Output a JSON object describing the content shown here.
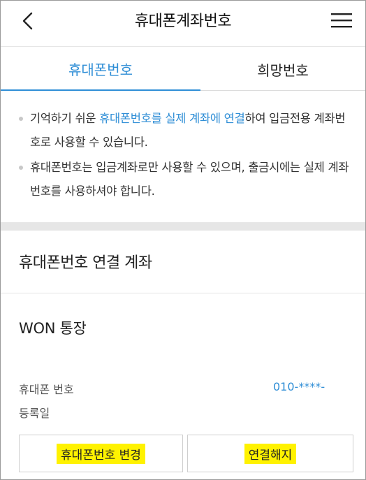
{
  "header": {
    "title": "휴대폰계좌번호",
    "back_icon": "chevron-left-icon",
    "menu_icon": "hamburger-menu-icon"
  },
  "tabs": [
    {
      "label": "휴대폰번호",
      "active": true
    },
    {
      "label": "희망번호",
      "active": false
    }
  ],
  "notes": {
    "note1": {
      "pre": "기억하기 쉬운 ",
      "highlight": "휴대폰번호를 실제 계좌에 연결",
      "post": "하여 입금전용 계좌번호로 사용할 수 있습니다."
    },
    "note2": {
      "text": "휴대폰번호는 입금계좌로만 사용할 수 있으며, 출금시에는 실제 계좌번호를 사용하셔야 합니다."
    }
  },
  "section": {
    "title": "휴대폰번호 연결 계좌"
  },
  "account": {
    "name": "WON 통장",
    "phone_label": "휴대폰 번호",
    "phone_value": "010-****-",
    "date_label": "등록일"
  },
  "buttons": {
    "change_label": "휴대폰번호 변경",
    "release_label": "연결해지"
  },
  "colors": {
    "accent": "#2f8ed6",
    "highlight": "#fff200",
    "band": "#e6e6e6"
  }
}
